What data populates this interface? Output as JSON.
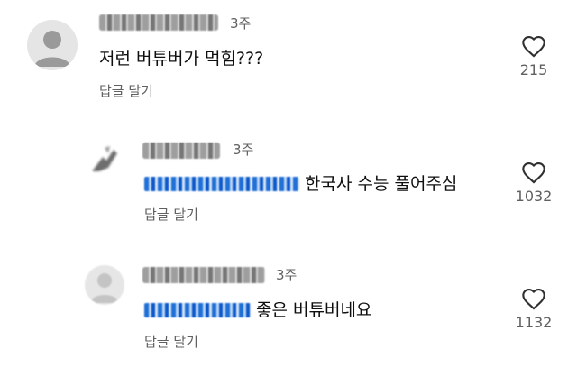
{
  "comments": [
    {
      "username": "",
      "time": "3주",
      "mention": "",
      "text": "저런 버튜버가 먹힘???",
      "reply_label": "답글 달기",
      "likes": "215",
      "avatar_icon": "default-person-icon"
    },
    {
      "username": "",
      "time": "3주",
      "mention": "",
      "text": "한국사 수능 풀어주심",
      "reply_label": "답글 달기",
      "likes": "1032",
      "avatar_icon": "blurred-avatar"
    },
    {
      "username": "",
      "time": "3주",
      "mention": "",
      "text": "좋은 버튜버네요",
      "reply_label": "답글 달기",
      "likes": "1132",
      "avatar_icon": "blurred-avatar"
    }
  ],
  "colors": {
    "text": "#0f0f0f",
    "secondary": "#606060",
    "mention": "#1f6fd6",
    "avatar_bg": "#e5e5e5",
    "avatar_fg": "#9a9a9a"
  }
}
